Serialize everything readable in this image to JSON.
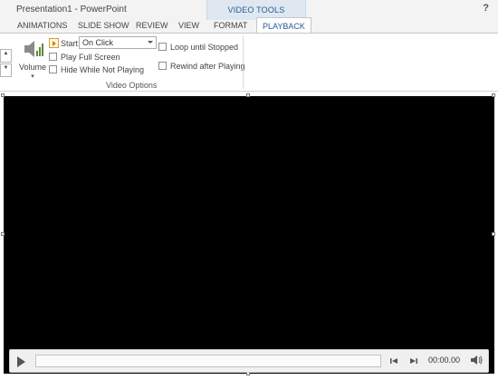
{
  "window": {
    "title": "Presentation1 - PowerPoint",
    "help": "?",
    "context_group": "VIDEO TOOLS"
  },
  "tabs": [
    {
      "label": "ANIMATIONS",
      "active": false
    },
    {
      "label": "SLIDE SHOW",
      "active": false
    },
    {
      "label": "REVIEW",
      "active": false
    },
    {
      "label": "VIEW",
      "active": false
    },
    {
      "label": "FORMAT",
      "active": false
    },
    {
      "label": "PLAYBACK",
      "active": true
    }
  ],
  "ribbon": {
    "volume": {
      "label": "Volume",
      "icon": "speaker-icon"
    },
    "start": {
      "label": "Start:",
      "value": "On Click"
    },
    "checkboxes": [
      {
        "label": "Play Full Screen",
        "checked": false
      },
      {
        "label": "Hide While Not Playing",
        "checked": false
      },
      {
        "label": "Loop until Stopped",
        "checked": false
      },
      {
        "label": "Rewind after Playing",
        "checked": false
      }
    ],
    "group_label": "Video Options"
  },
  "player": {
    "time": "00:00.00"
  },
  "colors": {
    "accent": "#2b579a",
    "context_tab_bg": "#dfe8f1",
    "video_bg": "#000000"
  }
}
